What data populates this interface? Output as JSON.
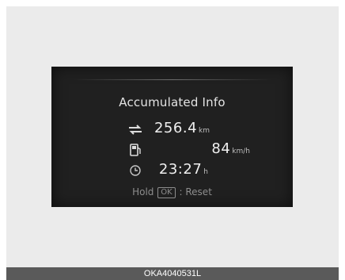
{
  "screen": {
    "title": "Accumulated Info",
    "rows": [
      {
        "icon": "distance-icon",
        "value": "256.4",
        "unit": "km"
      },
      {
        "icon": "fuel-pump-icon",
        "value": "84",
        "unit": "km/h"
      },
      {
        "icon": "clock-icon",
        "value": "23:27",
        "unit": "h"
      }
    ],
    "hint": {
      "prefix": "Hold",
      "button": "OK",
      "suffix": ": Reset"
    }
  },
  "caption": "OKA4040531L"
}
